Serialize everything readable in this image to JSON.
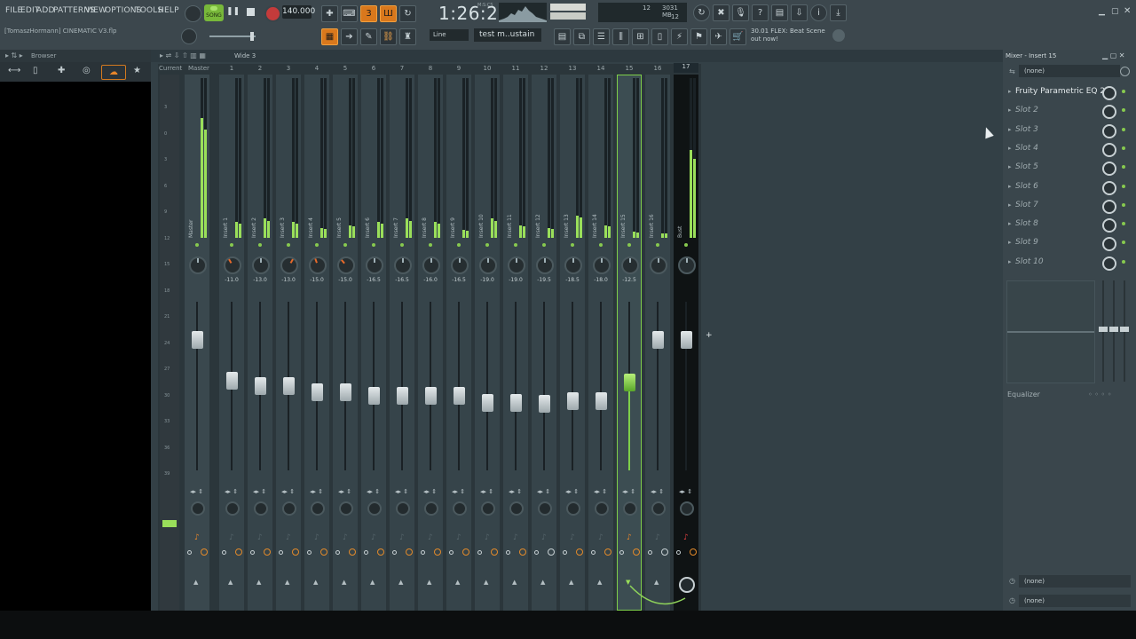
{
  "menu": [
    "FILE",
    "EDIT",
    "ADD",
    "PATTERNS",
    "VIEW",
    "OPTIONS",
    "TOOLS",
    "HELP"
  ],
  "transport": {
    "mode": "SONG",
    "tempo": "140.000",
    "time": "1:26:26",
    "time_unit": "M:S:CS",
    "play_icon": "pause-icon"
  },
  "cpu": {
    "memory": "3031 MB",
    "poly": "12",
    "cpu_top": "12"
  },
  "project_name": "[TomaszHormann] CINEMATIC V3.flp",
  "snap": "Line",
  "pattern": "test m..ustain",
  "hint": {
    "line1": "30.01  FLEX: Beat Scene",
    "line2": "out now!"
  },
  "browser": {
    "title": "Browser"
  },
  "mixer": {
    "preset": "Wide 3",
    "current_label": "Current",
    "master_label": "Master",
    "scale": [
      "3",
      "0",
      "3",
      "6",
      "9",
      "12",
      "15",
      "18",
      "21",
      "24",
      "27",
      "30",
      "33",
      "36",
      "39"
    ],
    "tracks": [
      {
        "num": "",
        "name": "Master",
        "vol": "",
        "meter": 0.75,
        "pan": 0,
        "fader": 0.72
      },
      {
        "num": "1",
        "name": "Insert 1",
        "vol": "-11.0",
        "meter": 0.1,
        "pan": -30,
        "fader": 0.48
      },
      {
        "num": "2",
        "name": "Insert 2",
        "vol": "-13.0",
        "meter": 0.12,
        "pan": 0,
        "fader": 0.45
      },
      {
        "num": "3",
        "name": "Insert 3",
        "vol": "-13.0",
        "meter": 0.1,
        "pan": 30,
        "fader": 0.45
      },
      {
        "num": "4",
        "name": "Insert 4",
        "vol": "-15.0",
        "meter": 0.06,
        "pan": -20,
        "fader": 0.41
      },
      {
        "num": "5",
        "name": "Insert 5",
        "vol": "-15.0",
        "meter": 0.08,
        "pan": -40,
        "fader": 0.41
      },
      {
        "num": "6",
        "name": "Insert 6",
        "vol": "-16.5",
        "meter": 0.1,
        "pan": 0,
        "fader": 0.39
      },
      {
        "num": "7",
        "name": "Insert 7",
        "vol": "-16.5",
        "meter": 0.12,
        "pan": 0,
        "fader": 0.39
      },
      {
        "num": "8",
        "name": "Insert 8",
        "vol": "-16.0",
        "meter": 0.1,
        "pan": 0,
        "fader": 0.39
      },
      {
        "num": "9",
        "name": "Insert 9",
        "vol": "-16.5",
        "meter": 0.05,
        "pan": 0,
        "fader": 0.39
      },
      {
        "num": "10",
        "name": "Insert 10",
        "vol": "-19.0",
        "meter": 0.12,
        "pan": 0,
        "fader": 0.35
      },
      {
        "num": "11",
        "name": "Insert 11",
        "vol": "-19.0",
        "meter": 0.08,
        "pan": 0,
        "fader": 0.35
      },
      {
        "num": "12",
        "name": "Insert 12",
        "vol": "-19.5",
        "meter": 0.06,
        "pan": 0,
        "fader": 0.34
      },
      {
        "num": "13",
        "name": "Insert 13",
        "vol": "-18.5",
        "meter": 0.14,
        "pan": 0,
        "fader": 0.36
      },
      {
        "num": "14",
        "name": "Insert 14",
        "vol": "-18.0",
        "meter": 0.08,
        "pan": 0,
        "fader": 0.36
      },
      {
        "num": "15",
        "name": "Insert 15",
        "vol": "-12.5",
        "meter": 0.04,
        "pan": 0,
        "fader": 0.47,
        "selected": true
      },
      {
        "num": "16",
        "name": "Insert 16",
        "vol": "",
        "meter": 0.03,
        "pan": 0,
        "fader": 0.72
      },
      {
        "num": "17",
        "name": "Bust",
        "vol": "",
        "meter": 0.55,
        "pan": 0,
        "fader": 0.72,
        "bus": true
      }
    ]
  },
  "insert_panel": {
    "title": "Mixer - Insert 15",
    "input": "(none)",
    "slots": [
      "Fruity Parametric EQ 2",
      "Slot 2",
      "Slot 3",
      "Slot 4",
      "Slot 5",
      "Slot 6",
      "Slot 7",
      "Slot 8",
      "Slot 9",
      "Slot 10"
    ],
    "eq_label": "Equalizer",
    "out1": "(none)",
    "out2": "(none)"
  }
}
